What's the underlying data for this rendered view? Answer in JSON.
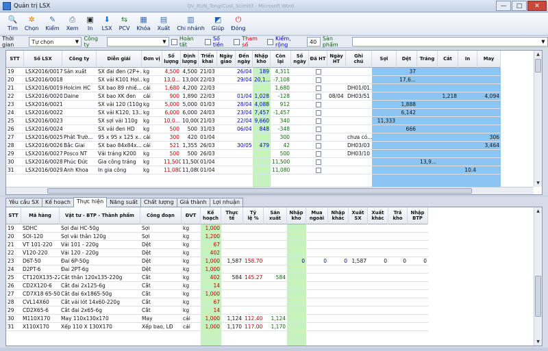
{
  "window": {
    "title": "Quản trị LSX",
    "ghost_title": "QV_RUN_Tong(Cust_Scimitif - Microsoft Word",
    "min": "—",
    "max": "□",
    "close": "✕"
  },
  "toolbar": [
    {
      "label": "Tìm",
      "icon": "search-icon",
      "glyph": "🔍",
      "color": "#1f5fbf"
    },
    {
      "label": "Chọn",
      "icon": "gear-icon",
      "glyph": "✲",
      "color": "#e07b00"
    },
    {
      "label": "Kiểm",
      "icon": "check-icon",
      "glyph": "✎",
      "color": "#3a6db3"
    },
    {
      "label": "Xem",
      "icon": "preview-icon",
      "glyph": "⎙",
      "color": "#546a8c"
    },
    {
      "label": "In",
      "icon": "printer-icon",
      "glyph": "▣",
      "color": "#222"
    },
    {
      "label": "LSX",
      "icon": "download-icon",
      "glyph": "⬇",
      "color": "#1a73d9"
    },
    {
      "label": "PCV",
      "icon": "transfer-icon",
      "glyph": "⇆",
      "color": "#2a8c2a"
    },
    {
      "label": "Khóa",
      "icon": "calendar-lock-icon",
      "glyph": "▦",
      "color": "#3a6db3"
    },
    {
      "label": "Xuất",
      "icon": "export-icon",
      "glyph": "▤",
      "color": "#3a6db3"
    },
    {
      "label": "Chi nhánh",
      "icon": "branch-icon",
      "glyph": "▥",
      "color": "#3a6db3"
    },
    {
      "label": "Giúp",
      "icon": "help-icon",
      "glyph": "◩",
      "color": "#1f5fbf"
    },
    {
      "label": "Đóng",
      "icon": "power-icon",
      "glyph": "⏻",
      "color": "#d22"
    }
  ],
  "filter": {
    "time_label": "Thời gian",
    "time_value": "Tự chọn",
    "company_label": "Công ty",
    "company_value": "",
    "done_label": "Hoàn tất",
    "money_label": "Số tiền",
    "param_label": "Tham số",
    "check_label": "Kiểm, rộng",
    "check_value": "40",
    "product_label": "Sản phẩm",
    "product_value": ""
  },
  "top_table": {
    "columns": [
      "STT",
      "Số LSX",
      "Công ty",
      "Diễn giải",
      "Đơn vị",
      "Số\nlượng",
      "Định\nlượng",
      "Triển\nkhai",
      "Ngày\ngiao",
      "Đến\nngày",
      "Nhập\nkho",
      "Còn\nlại",
      "Số\nngày",
      "Đã HT",
      "Ngày\nHT",
      "Ghi\nchú",
      "Sợi",
      "Dệt",
      "Tráng",
      "Cắt",
      "In",
      "May"
    ],
    "rows": [
      [
        "19",
        "LSX2016/0017",
        "Sản xuất",
        "SX đai đen (2P+...",
        "kg",
        "4,500",
        "4,500",
        "21/03",
        "",
        "26/04",
        "189",
        "4,311",
        "",
        "",
        "",
        "",
        "",
        "37",
        "",
        "",
        "",
        ""
      ],
      [
        "20",
        "LSX2016/0018",
        "",
        "SX vải K101 Hol...",
        "kg",
        "13,0...",
        "13,000",
        "22/03",
        "",
        "29/04",
        "20,1...",
        "-7,108",
        "",
        "",
        "",
        "",
        "",
        "17,6...",
        "",
        "",
        "",
        ""
      ],
      [
        "21",
        "LSX2016/0019",
        "Holcim HC",
        "SX bao 89 nhiề...",
        "cái",
        "1,680",
        "4,200",
        "22/03",
        "",
        "",
        "",
        "1,680",
        "",
        "",
        "",
        "DH01/01...",
        "",
        "",
        "",
        "",
        "",
        ""
      ],
      [
        "22",
        "LSX2016/0020",
        "Daine",
        "SX bao XK đen",
        "cái",
        "900",
        "1,890",
        "22/03",
        "",
        "01/04",
        "1,028",
        "-128",
        "",
        "",
        "08/04",
        "DH03/51",
        "",
        "",
        "",
        "1,218",
        "",
        "4,094"
      ],
      [
        "23",
        "LSX2016/0021",
        "",
        "SX vải 120 (110g)",
        "kg",
        "5,000",
        "5,000",
        "01/03",
        "",
        "28/04",
        "4,088",
        "912",
        "",
        "",
        "",
        "",
        "",
        "1,888",
        "",
        "",
        "",
        ""
      ],
      [
        "24",
        "LSX2016/0022",
        "",
        "SX vải K120, 13...",
        "kg",
        "6,000",
        "6,000",
        "24/03",
        "",
        "23/04",
        "7,457",
        "-1,457",
        "",
        "",
        "",
        "",
        "",
        "6,142",
        "",
        "",
        "",
        ""
      ],
      [
        "25",
        "LSX2016/0023",
        "",
        "SX sợi vải 110g",
        "kg",
        "10,0...",
        "10,000",
        "21/03",
        "",
        "22/04",
        "9,660",
        "340",
        "",
        "",
        "",
        "",
        "11,333",
        "",
        "",
        "",
        "",
        ""
      ],
      [
        "26",
        "LSX2016/0024",
        "",
        "SX vải đen HD",
        "kg",
        "500",
        "500",
        "31/03",
        "",
        "06/04",
        "848",
        "-348",
        "",
        "",
        "",
        "",
        "",
        "666",
        "",
        "",
        "",
        ""
      ],
      [
        "27",
        "LSX2016/0025",
        "Phát Trườ...",
        "95 x 95 x 125 x...",
        "cái",
        "300",
        "420",
        "01/04",
        "",
        "",
        "",
        "300",
        "",
        "",
        "",
        "chưa có...",
        "",
        "",
        "",
        "",
        "",
        "306"
      ],
      [
        "28",
        "LSX2016/0026",
        "Bắc Giai",
        "SX bao 84x84x...",
        "cái",
        "521",
        "1,355",
        "26/03",
        "",
        "30/05",
        "479",
        "42",
        "",
        "",
        "",
        "DH03/03",
        "",
        "",
        "",
        "",
        "",
        "3,464"
      ],
      [
        "29",
        "LSX2016/0027",
        "Posco NT",
        "Vải tráng K200",
        "kg",
        "500",
        "500",
        "26/03",
        "",
        "",
        "",
        "500",
        "",
        "",
        "",
        "DH03/10",
        "",
        "",
        "",
        "",
        "",
        ""
      ],
      [
        "30",
        "LSX2016/0028",
        "Phúc Đức",
        "Gia công tráng",
        "kg",
        "11,500",
        "11,500",
        "01/04",
        "",
        "",
        "",
        "11,500",
        "",
        "",
        "",
        "",
        "",
        "",
        "13,9...",
        "",
        "",
        ""
      ],
      [
        "31",
        "LSX2016/0029",
        "Anh Khoa",
        "In gia công",
        "kg",
        "11,080",
        "11,080",
        "01/04",
        "",
        "",
        "",
        "11,080",
        "",
        "",
        "",
        "",
        "",
        "",
        "",
        "",
        "10.4",
        ""
      ]
    ]
  },
  "tabs": [
    "Yêu cầu SX",
    "Kế hoạch",
    "Thực hiện",
    "Năng suất",
    "Chất lượng",
    "Giá thành",
    "Lợi nhuận"
  ],
  "bottom_table": {
    "columns": [
      "STT",
      "Mã hàng",
      "Vật tư - BTP - Thành phẩm",
      "Công đoạn",
      "ĐVT",
      "Kế\nhoạch",
      "Thực\ntế",
      "Tỷ\nlệ %",
      "Sản\nxuất",
      "Nhập\nkho",
      "Mua\nngoài",
      "Nhập\nkhác",
      "Xuất\nSX",
      "Xuất\nkhác",
      "Trả\nkho",
      "Nhập\nBTP"
    ],
    "rows": [
      [
        "19",
        "SDHC",
        "Sợi đai HC-50g",
        "Sợi",
        "kg",
        "1,000",
        "",
        "",
        "",
        "",
        "",
        "",
        "",
        "",
        "",
        ""
      ],
      [
        "20",
        "SOI-120",
        "Sợi vải thân 120g",
        "Sợi",
        "kg",
        "1,200",
        "",
        "",
        "",
        "",
        "",
        "",
        "",
        "",
        "",
        ""
      ],
      [
        "21",
        "VT 101-220",
        "Vải 101 - 220g",
        "Dệt",
        "kg",
        "67",
        "",
        "",
        "",
        "",
        "",
        "",
        "",
        "",
        "",
        ""
      ],
      [
        "22",
        "V120-220",
        "Vải 120 - 220g",
        "Dệt",
        "kg",
        "402",
        "",
        "",
        "",
        "",
        "",
        "",
        "",
        "",
        "",
        ""
      ],
      [
        "23",
        "D6T-50",
        "Đai 6P-50g",
        "Dệt",
        "kg",
        "1,000",
        "1,587",
        "158.70",
        "",
        "0",
        "0",
        "0",
        "1,587",
        "0",
        "0",
        "0"
      ],
      [
        "24",
        "D2PT-6",
        "Đai 2PT-6g",
        "Dệt",
        "kg",
        "1,000",
        "",
        "",
        "",
        "",
        "",
        "",
        "",
        "",
        "",
        ""
      ],
      [
        "25",
        "CT120X135-220",
        "Cắt  thân 120x135-220g",
        "Cắt",
        "kg",
        "402",
        "584",
        "145.27",
        "584",
        "",
        "",
        "",
        "",
        "",
        "",
        ""
      ],
      [
        "26",
        "CD2X120-6",
        "Cắt đai 2x125-6g",
        "Cắt",
        "kg",
        "14",
        "",
        "",
        "",
        "",
        "",
        "",
        "",
        "",
        "",
        ""
      ],
      [
        "27",
        "CD7X18 65-50",
        "Cắt đai 6x1865-50g",
        "Cắt",
        "kg",
        "1,000",
        "",
        "",
        "",
        "",
        "",
        "",
        "",
        "",
        "",
        ""
      ],
      [
        "28",
        "CVL14X60",
        "Cắt vải lót 14x60-220g",
        "Cắt",
        "kg",
        "67",
        "",
        "",
        "",
        "",
        "",
        "",
        "",
        "",
        "",
        ""
      ],
      [
        "29",
        "CD2X65-6",
        "Cắt đai 2x65-6g",
        "Cắt",
        "kg",
        "14",
        "",
        "",
        "",
        "",
        "",
        "",
        "",
        "",
        "",
        ""
      ],
      [
        "30",
        "M110X170",
        "May 110x130x170",
        "May",
        "cái",
        "1,000",
        "1,124",
        "112.40",
        "1,124",
        "",
        "",
        "",
        "",
        "",
        "",
        ""
      ],
      [
        "31",
        "X110X170",
        "Xếp 110 X 130X170",
        "Xếp bao, LĐ",
        "cái",
        "1,000",
        "1,170",
        "117.00",
        "1,170",
        "",
        "",
        "",
        "",
        "",
        "",
        ""
      ]
    ]
  },
  "colors": {
    "blue_band": "#8cc4f2",
    "green_band": "#c6f2c0",
    "red_text": "#c00000",
    "blue_text": "#0000cc",
    "green_text": "#0b6e0b"
  }
}
